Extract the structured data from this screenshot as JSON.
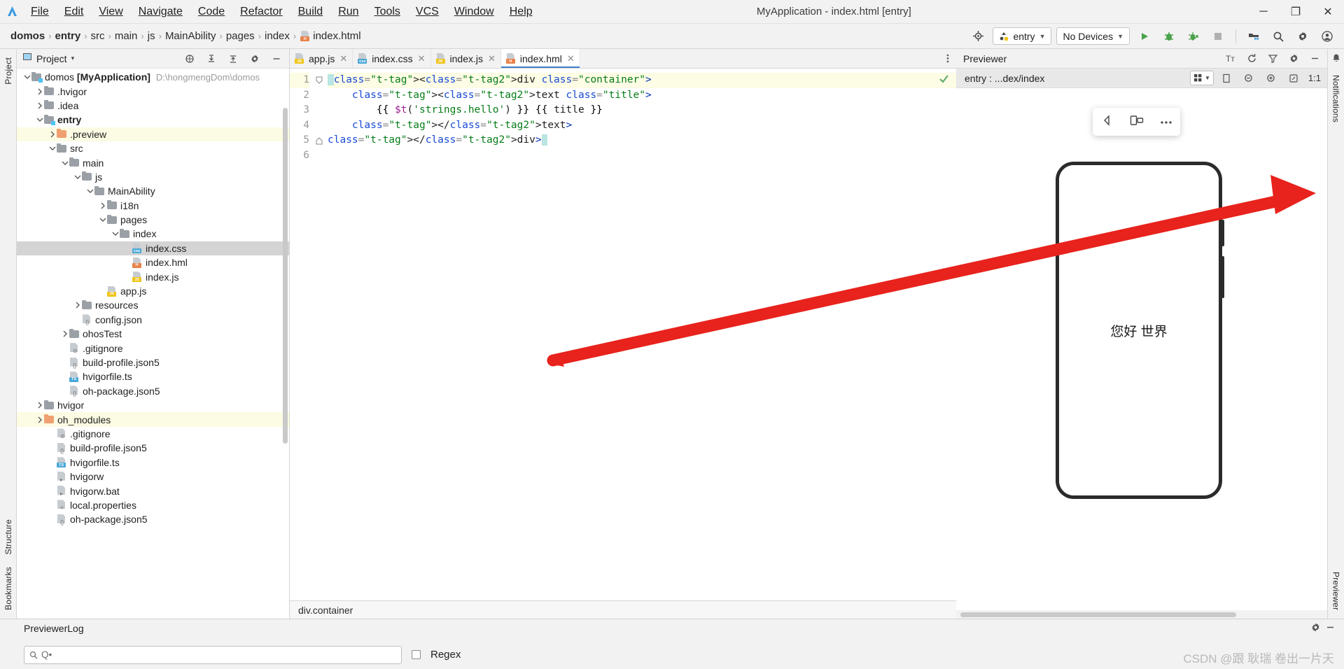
{
  "window": {
    "title": "MyApplication - index.html [entry]",
    "minimize": "─",
    "maximize": "❐",
    "close": "✕"
  },
  "menubar": {
    "items": [
      {
        "label": "File"
      },
      {
        "label": "Edit"
      },
      {
        "label": "View"
      },
      {
        "label": "Navigate"
      },
      {
        "label": "Code"
      },
      {
        "label": "Refactor"
      },
      {
        "label": "Build"
      },
      {
        "label": "Run"
      },
      {
        "label": "Tools"
      },
      {
        "label": "VCS"
      },
      {
        "label": "Window"
      },
      {
        "label": "Help"
      }
    ]
  },
  "breadcrumb": {
    "items": [
      "domos",
      "entry",
      "src",
      "main",
      "js",
      "MainAbility",
      "pages",
      "index",
      "index.html"
    ],
    "separator": "›",
    "file_icon": "html-file-icon"
  },
  "toolbar": {
    "target_icon": "target-icon",
    "module_selector": "entry",
    "device_selector": "No Devices",
    "dropdown_caret": "▼",
    "actions": [
      {
        "name": "run-button",
        "icon": "run-icon"
      },
      {
        "name": "debug-button",
        "icon": "debug-icon"
      },
      {
        "name": "profile-button",
        "icon": "profile-icon"
      },
      {
        "name": "stop-button",
        "icon": "stop-icon"
      },
      {
        "name": "project-structure-button",
        "icon": "project-structure-icon"
      },
      {
        "name": "search-button",
        "icon": "search-icon"
      },
      {
        "name": "settings-button",
        "icon": "gear-icon"
      },
      {
        "name": "account-button",
        "icon": "account-icon"
      }
    ]
  },
  "left_rail": {
    "top_tab": "Project",
    "bottom_tabs": [
      "Structure",
      "Bookmarks"
    ]
  },
  "right_rail": {
    "tabs": [
      "Notifications",
      "Previewer"
    ]
  },
  "project_panel": {
    "title": "Project",
    "caret": "▾",
    "actions": [
      "locate-icon",
      "expand-all-icon",
      "collapse-all-icon",
      "gear-icon",
      "hide-icon"
    ],
    "tree": [
      {
        "depth": 0,
        "arrow": "down",
        "icon": "module-folder",
        "label": "domos ",
        "bold_label": "[MyApplication]",
        "path": "D:\\hongmengDom\\domos",
        "state": "normal"
      },
      {
        "depth": 1,
        "arrow": "right",
        "icon": "folder",
        "label": ".hvigor",
        "state": "normal"
      },
      {
        "depth": 1,
        "arrow": "right",
        "icon": "folder",
        "label": ".idea",
        "state": "normal"
      },
      {
        "depth": 1,
        "arrow": "down",
        "icon": "module-folder",
        "label": "entry",
        "bold": true,
        "state": "normal"
      },
      {
        "depth": 2,
        "arrow": "right",
        "icon": "folder-orange",
        "label": ".preview",
        "state": "highlight"
      },
      {
        "depth": 2,
        "arrow": "down",
        "icon": "folder",
        "label": "src",
        "state": "normal"
      },
      {
        "depth": 3,
        "arrow": "down",
        "icon": "folder",
        "label": "main",
        "state": "normal"
      },
      {
        "depth": 4,
        "arrow": "down",
        "icon": "folder",
        "label": "js",
        "state": "normal"
      },
      {
        "depth": 5,
        "arrow": "down",
        "icon": "folder",
        "label": "MainAbility",
        "state": "normal"
      },
      {
        "depth": 6,
        "arrow": "right",
        "icon": "folder",
        "label": "i18n",
        "state": "normal"
      },
      {
        "depth": 6,
        "arrow": "down",
        "icon": "folder",
        "label": "pages",
        "state": "normal"
      },
      {
        "depth": 7,
        "arrow": "down",
        "icon": "folder",
        "label": "index",
        "state": "normal"
      },
      {
        "depth": 8,
        "arrow": "none",
        "icon": "css-file",
        "label": "index.css",
        "state": "selected"
      },
      {
        "depth": 8,
        "arrow": "none",
        "icon": "html-file",
        "label": "index.hml",
        "state": "normal"
      },
      {
        "depth": 8,
        "arrow": "none",
        "icon": "js-file",
        "label": "index.js",
        "state": "normal"
      },
      {
        "depth": 6,
        "arrow": "none",
        "icon": "js-file",
        "label": "app.js",
        "state": "normal"
      },
      {
        "depth": 4,
        "arrow": "right",
        "icon": "folder",
        "label": "resources",
        "state": "normal"
      },
      {
        "depth": 4,
        "arrow": "none",
        "icon": "json-file",
        "label": "config.json",
        "state": "normal"
      },
      {
        "depth": 3,
        "arrow": "right",
        "icon": "folder",
        "label": "ohosTest",
        "state": "normal"
      },
      {
        "depth": 3,
        "arrow": "none",
        "icon": "gitignore-file",
        "label": ".gitignore",
        "state": "normal"
      },
      {
        "depth": 3,
        "arrow": "none",
        "icon": "json-file",
        "label": "build-profile.json5",
        "state": "normal"
      },
      {
        "depth": 3,
        "arrow": "none",
        "icon": "ts-file",
        "label": "hvigorfile.ts",
        "state": "normal"
      },
      {
        "depth": 3,
        "arrow": "none",
        "icon": "json-file",
        "label": "oh-package.json5",
        "state": "normal"
      },
      {
        "depth": 1,
        "arrow": "right",
        "icon": "folder",
        "label": "hvigor",
        "state": "normal"
      },
      {
        "depth": 1,
        "arrow": "right",
        "icon": "folder-orange",
        "label": "oh_modules",
        "state": "highlight"
      },
      {
        "depth": 2,
        "arrow": "none",
        "icon": "gitignore-file",
        "label": ".gitignore",
        "state": "normal"
      },
      {
        "depth": 2,
        "arrow": "none",
        "icon": "json-file",
        "label": "build-profile.json5",
        "state": "normal"
      },
      {
        "depth": 2,
        "arrow": "none",
        "icon": "ts-file",
        "label": "hvigorfile.ts",
        "state": "normal"
      },
      {
        "depth": 2,
        "arrow": "none",
        "icon": "script-file",
        "label": "hvigorw",
        "state": "normal"
      },
      {
        "depth": 2,
        "arrow": "none",
        "icon": "script-file",
        "label": "hvigorw.bat",
        "state": "normal"
      },
      {
        "depth": 2,
        "arrow": "none",
        "icon": "properties-file",
        "label": "local.properties",
        "state": "normal"
      },
      {
        "depth": 2,
        "arrow": "none",
        "icon": "json-file",
        "label": "oh-package.json5",
        "state": "normal"
      }
    ]
  },
  "editor": {
    "tabs": [
      {
        "label": "app.js",
        "icon": "js-file",
        "active": false,
        "close": "✕"
      },
      {
        "label": "index.css",
        "icon": "css-file",
        "active": false,
        "close": "✕"
      },
      {
        "label": "index.js",
        "icon": "js-file",
        "active": false,
        "close": "✕"
      },
      {
        "label": "index.hml",
        "icon": "html-file",
        "active": true,
        "close": "✕"
      }
    ],
    "more_icon": "more-vertical-icon",
    "gutter": [
      "1",
      "2",
      "3",
      "4",
      "5",
      "6"
    ],
    "current_line": 1,
    "lines": [
      "<div class=\"container\">",
      "    <text class=\"title\">",
      "        {{ $t('strings.hello') }} {{ title }}",
      "    </text>",
      "</div>",
      ""
    ],
    "inspection_status": "inspection-ok-icon",
    "status_line": "div.container"
  },
  "previewer": {
    "title": "Previewer",
    "header_actions": [
      "font-size-icon",
      "refresh-icon",
      "filter-icon",
      "settings-icon",
      "hide-icon"
    ],
    "route": "entry : ...dex/index",
    "ok_icon": "check-icon",
    "layout_selector": "grid-icon",
    "caret": "▼",
    "zoom_actions": [
      "frame-icon",
      "zoom-out-icon",
      "zoom-in-icon",
      "fit-icon"
    ],
    "scale_label": "1:1",
    "float_tools": [
      "back-icon",
      "rotate-icon",
      "more-icon"
    ],
    "device_text": "您好 世界"
  },
  "log_panel": {
    "title": "PreviewerLog",
    "actions": [
      "gear-icon",
      "hide-icon"
    ],
    "search_placeholder": "Q•",
    "search_value": "",
    "search_icon": "search-icon",
    "regex_label": "Regex",
    "regex_checked": false
  },
  "watermark": "CSDN @跟 耿瑞 卷出一片天",
  "colors": {
    "accent": "#3d7fd0",
    "arrow": "#e8221c",
    "highlight_row": "#fcfbe3",
    "selected_row": "#d4d4d4",
    "folder_orange": "#f0a070"
  }
}
